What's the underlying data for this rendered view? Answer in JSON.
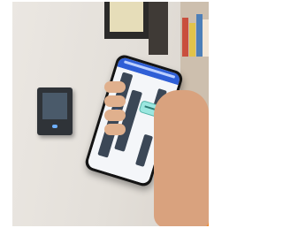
{
  "photo": {
    "subject": "hand-holding-smartphone-with-indoor-map",
    "colors": {
      "wall": "#e6e2dc",
      "phone": "#141414",
      "app_bar": "#2f5fd6",
      "map_shelves": "#3b4756",
      "badge": "#9be7e0",
      "skin": "#d9a27e",
      "wall_reader": "#2f3338"
    }
  }
}
